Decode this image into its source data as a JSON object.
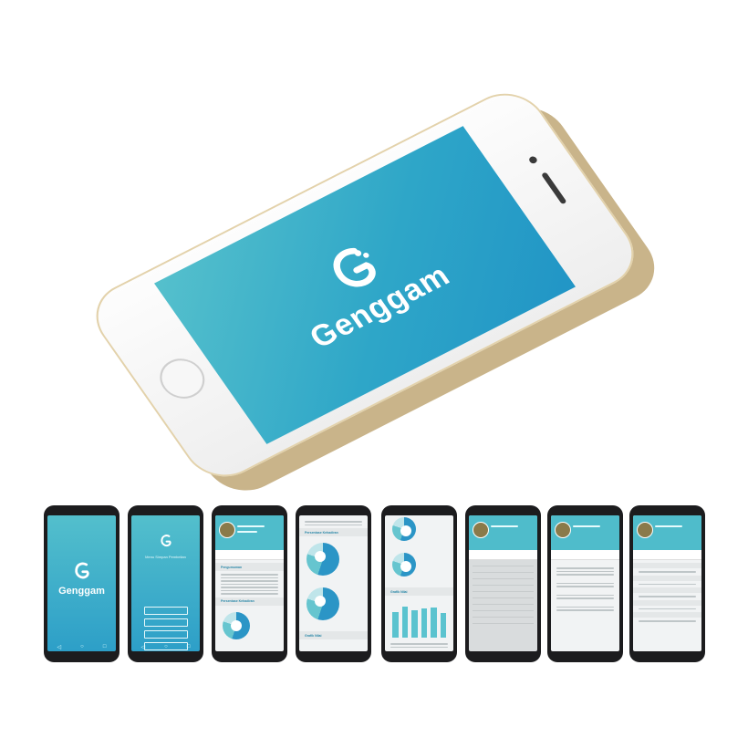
{
  "hero": {
    "brand_name": "Genggam",
    "logo_icon": "hand-g-logo-icon",
    "screen_gradient": [
      "#55c0cc",
      "#2195c6"
    ],
    "device_color": "#e3d2ab"
  },
  "screens": [
    {
      "id": "splash",
      "brand_name": "Genggam"
    },
    {
      "id": "login",
      "subtitle": "Menu Simpan Pembelian",
      "buttons": [
        "",
        "",
        "",
        ""
      ]
    },
    {
      "id": "profile-feed",
      "sections": [
        "Pengumuman",
        "Persentase Kehadiran"
      ]
    },
    {
      "id": "attendance-chart",
      "sections": [
        "Persentase Kehadiran",
        "Grafik Nilai"
      ]
    },
    {
      "id": "grade-chart",
      "sections": [
        "Grafik Nilai"
      ]
    },
    {
      "id": "table-view",
      "tab_selected": "Absensi"
    },
    {
      "id": "task-list",
      "tab_selected": "Tugas"
    },
    {
      "id": "schedule-list",
      "tab_selected": "Jadwal"
    }
  ]
}
